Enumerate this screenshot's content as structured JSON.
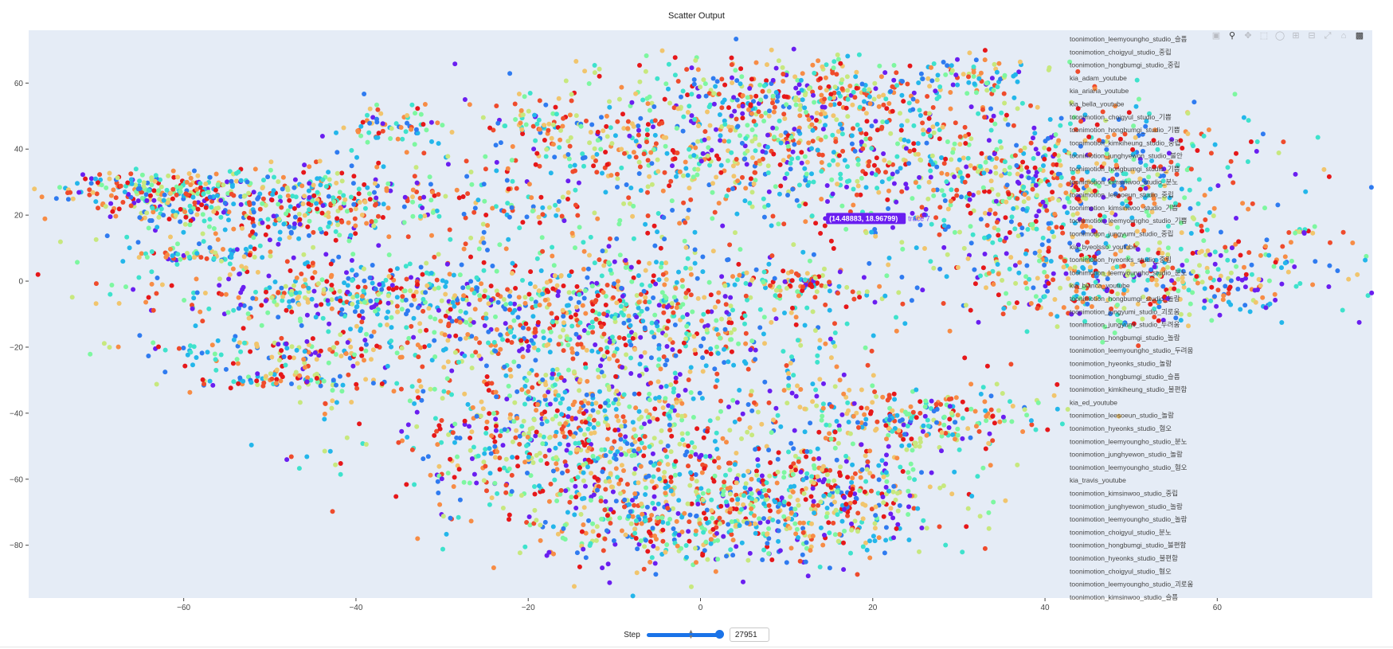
{
  "header": {
    "title": "Scatter Output"
  },
  "controls": {
    "step_label": "Step",
    "step_value": "27951",
    "slider_fraction": 1.0
  },
  "modebar": {
    "buttons": [
      "camera-icon",
      "zoom-icon",
      "pan-icon",
      "box-select-icon",
      "lasso-icon",
      "zoom-in-icon",
      "zoom-out-icon",
      "autoscale-icon",
      "reset-axes-icon",
      "plotly-logo-icon"
    ]
  },
  "chart_data": {
    "type": "scatter",
    "title": "",
    "xlabel": "",
    "ylabel": "",
    "xlim": [
      -78,
      78
    ],
    "ylim": [
      -96,
      76
    ],
    "x_ticks": [
      -60,
      -40,
      -20,
      0,
      20,
      40,
      60
    ],
    "y_ticks": [
      60,
      40,
      20,
      0,
      -20,
      -40,
      -60,
      -80
    ],
    "x_tick_labels": [
      "−60",
      "−40",
      "−20",
      "0",
      "20",
      "40",
      "60"
    ],
    "y_tick_labels": [
      "60",
      "40",
      "20",
      "0",
      "−20",
      "−40",
      "−60",
      "−80"
    ],
    "grid": false,
    "background": "#e5ecf6",
    "legend_position": "right-inside",
    "palette": [
      "#6a1ef0",
      "#2f7bf0",
      "#23b6ea",
      "#3ee2cc",
      "#7df7a0",
      "#c7e87e",
      "#f1c56d",
      "#f78c45",
      "#ef4b2c",
      "#e6171a"
    ],
    "hover": {
      "x": 14.48883,
      "y": 18.96799,
      "label": "(14.48883, 18.96799)",
      "trace": "trace 7"
    },
    "clusters": [
      {
        "cx": -63,
        "cy": 28,
        "sx": 6,
        "sy": 3,
        "n": 180
      },
      {
        "cx": -46,
        "cy": 23,
        "sx": 11,
        "sy": 6,
        "n": 420
      },
      {
        "cx": -36,
        "cy": 47,
        "sx": 3,
        "sy": 3,
        "n": 60
      },
      {
        "cx": -57,
        "cy": 8,
        "sx": 4,
        "sy": 1.5,
        "n": 70
      },
      {
        "cx": -62,
        "cy": 21,
        "sx": 3,
        "sy": 1,
        "n": 30
      },
      {
        "cx": -40,
        "cy": -4,
        "sx": 12,
        "sy": 5,
        "n": 380
      },
      {
        "cx": -46,
        "cy": -21,
        "sx": 10,
        "sy": 2,
        "n": 120
      },
      {
        "cx": -49,
        "cy": -30,
        "sx": 6,
        "sy": 2,
        "n": 90
      },
      {
        "cx": -19,
        "cy": 48,
        "sx": 2,
        "sy": 3,
        "n": 40
      },
      {
        "cx": -20,
        "cy": 22,
        "sx": 3,
        "sy": 2,
        "n": 30
      },
      {
        "cx": 5,
        "cy": 40,
        "sx": 16,
        "sy": 11,
        "n": 750
      },
      {
        "cx": 14,
        "cy": 58,
        "sx": 9,
        "sy": 5,
        "n": 240
      },
      {
        "cx": 31,
        "cy": 63,
        "sx": 4,
        "sy": 3,
        "n": 70
      },
      {
        "cx": 40,
        "cy": 30,
        "sx": 13,
        "sy": 12,
        "n": 650
      },
      {
        "cx": 51,
        "cy": 0,
        "sx": 12,
        "sy": 7,
        "n": 420
      },
      {
        "cx": 12,
        "cy": -1,
        "sx": 3,
        "sy": 2,
        "n": 70
      },
      {
        "cx": -10,
        "cy": -12,
        "sx": 15,
        "sy": 14,
        "n": 900
      },
      {
        "cx": -14,
        "cy": -47,
        "sx": 12,
        "sy": 12,
        "n": 700
      },
      {
        "cx": 2,
        "cy": -72,
        "sx": 11,
        "sy": 8,
        "n": 520
      },
      {
        "cx": 24,
        "cy": -42,
        "sx": 8,
        "sy": 5,
        "n": 260
      },
      {
        "cx": 13,
        "cy": -62,
        "sx": 9,
        "sy": 7,
        "n": 300
      },
      {
        "cx": 70,
        "cy": 15,
        "sx": 1.2,
        "sy": 0.6,
        "n": 12
      }
    ],
    "legend_entries": [
      "toonimotion_leemyoungho_studio_슬픔",
      "toonimotion_choigyul_studio_중립",
      "toonimotion_hongbumgi_studio_중립",
      "kia_adam_youtube",
      "kia_ariana_youtube",
      "kia_bella_youtube",
      "toonimotion_choigyul_studio_기쁨",
      "toonimotion_hongbumgi_studio_기쁨",
      "toonimotion_kimkiheung_studio_중립",
      "toonimotion_junghyewon_studio_불안",
      "toonimotion_hongbumgi_studio_기쁨",
      "toonimotion_kimsinwoo_studio_분노",
      "toonimotion_leesoeun_studio_중립",
      "toonimotion_kimsinwoo_studio_기쁨",
      "toonimotion_leemyoungho_studio_기쁨",
      "toonimotion_jungyumi_studio_중립",
      "kia_byeolsso_youtube",
      "toonimotion_hyeonks_studio_중립",
      "toonimotion_leemyoungho_studio_분노",
      "kia_bianca_youtube",
      "toonimotion_hongbumgi_studio_놀람",
      "toonimotion_jungyumi_studio_괴로움",
      "toonimotion_jungyumi_studio_두려움",
      "toonimotion_hongbumgi_studio_놀람",
      "toonimotion_leemyoungho_studio_두려움",
      "toonimotion_hyeonks_studio_놀람",
      "toonimotion_hongbumgi_studio_슬픔",
      "toonimotion_kimkiheung_studio_불편함",
      "kia_ed_youtube",
      "toonimotion_leesoeun_studio_놀람",
      "toonimotion_hyeonks_studio_혐오",
      "toonimotion_leemyoungho_studio_분노",
      "toonimotion_junghyewon_studio_놀람",
      "toonimotion_leemyoungho_studio_혐오",
      "kia_travis_youtube",
      "toonimotion_kimsinwoo_studio_중립",
      "toonimotion_junghyewon_studio_놀람",
      "toonimotion_leemyoungho_studio_놀람",
      "toonimotion_choigyul_studio_분노",
      "toonimotion_hongbumgi_studio_불편함",
      "toonimotion_hyeonks_studio_불편함",
      "toonimotion_choigyul_studio_혐오",
      "toonimotion_leemyoungho_studio_괴로움",
      "toonimotion_kimsinwoo_studio_슬픔"
    ]
  }
}
